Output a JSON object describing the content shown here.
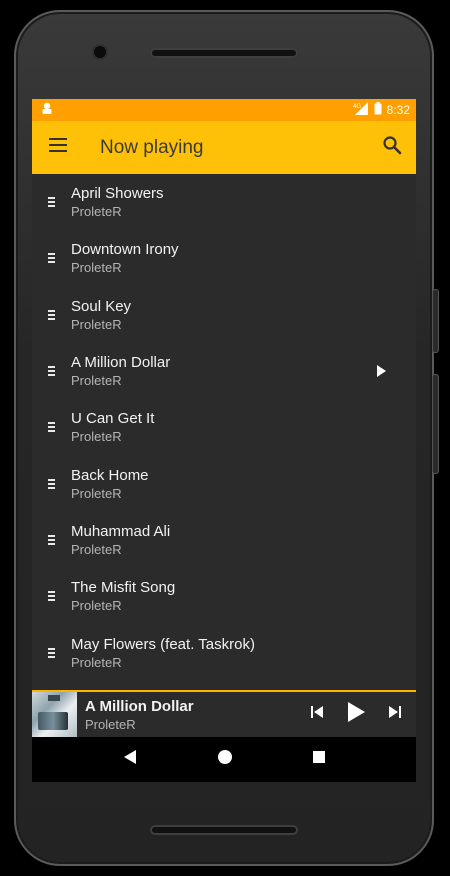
{
  "status_bar": {
    "time": "8:32",
    "network": "4G"
  },
  "toolbar": {
    "title": "Now playing"
  },
  "playlist": [
    {
      "title": "April Showers",
      "artist": "ProleteR"
    },
    {
      "title": "Downtown Irony",
      "artist": "ProleteR"
    },
    {
      "title": "Soul Key",
      "artist": "ProleteR"
    },
    {
      "title": "A Million Dollar",
      "artist": "ProleteR"
    },
    {
      "title": "U Can Get It",
      "artist": "ProleteR"
    },
    {
      "title": "Back Home",
      "artist": "ProleteR"
    },
    {
      "title": "Muhammad Ali",
      "artist": "ProleteR"
    },
    {
      "title": "The Misfit Song",
      "artist": "ProleteR"
    },
    {
      "title": "May Flowers (feat. Taskrok)",
      "artist": "ProleteR"
    }
  ],
  "now_playing": {
    "title": "A Million Dollar",
    "artist": "ProleteR"
  },
  "colors": {
    "status_bar": "#ffa000",
    "toolbar": "#ffc107",
    "accent": "#ffb300",
    "background": "#2b2b2b"
  },
  "icons": [
    "menu-icon",
    "search-icon",
    "drag-handle-icon",
    "play-icon",
    "skip-previous-icon",
    "skip-next-icon",
    "back-icon",
    "home-icon",
    "recents-icon"
  ]
}
